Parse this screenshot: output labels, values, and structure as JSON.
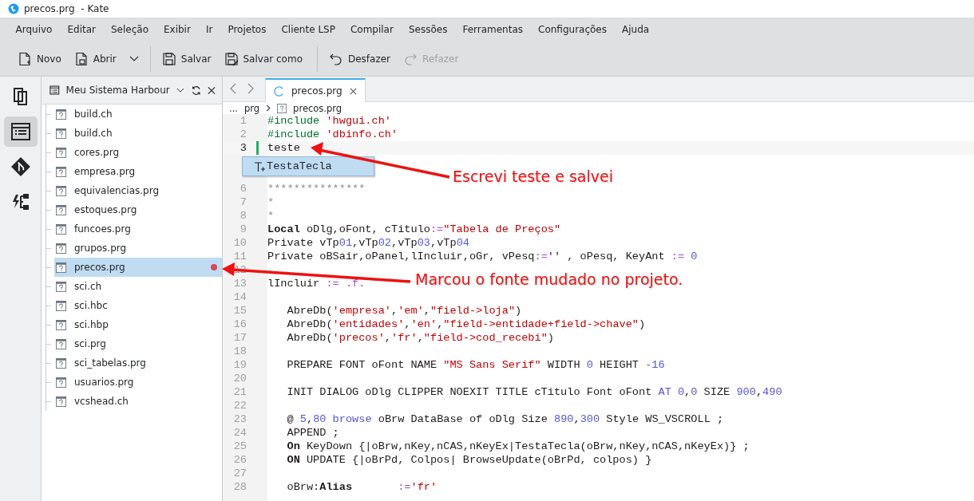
{
  "window": {
    "title": "precos.prg  - Kate"
  },
  "menu": [
    "Arquivo",
    "Editar",
    "Seleção",
    "Exibir",
    "Ir",
    "Projetos",
    "Cliente LSP",
    "Compilar",
    "Sessões",
    "Ferramentas",
    "Configurações",
    "Ajuda"
  ],
  "toolbar": [
    {
      "kind": "new",
      "label": "Novo",
      "disabled": false
    },
    {
      "kind": "open",
      "label": "Abrir",
      "disabled": false,
      "dropdown": true,
      "separator_after": true
    },
    {
      "kind": "save",
      "label": "Salvar",
      "disabled": false
    },
    {
      "kind": "saveas",
      "label": "Salvar como",
      "disabled": false,
      "separator_after": true
    },
    {
      "kind": "undo",
      "label": "Desfazer",
      "disabled": false
    },
    {
      "kind": "redo",
      "label": "Refazer",
      "disabled": true
    }
  ],
  "sidebar": [
    {
      "kind": "documents",
      "selected": false
    },
    {
      "kind": "project",
      "selected": true
    },
    {
      "kind": "git",
      "selected": false
    },
    {
      "kind": "lsp",
      "selected": false
    }
  ],
  "project": {
    "title": "Meu Sistema Harbour",
    "files": [
      {
        "name": "build.ch",
        "selected": false,
        "modified": false
      },
      {
        "name": "build.ch",
        "selected": false,
        "modified": false
      },
      {
        "name": "cores.prg",
        "selected": false,
        "modified": false
      },
      {
        "name": "empresa.prg",
        "selected": false,
        "modified": false
      },
      {
        "name": "equivalencias.prg",
        "selected": false,
        "modified": false
      },
      {
        "name": "estoques.prg",
        "selected": false,
        "modified": false
      },
      {
        "name": "funcoes.prg",
        "selected": false,
        "modified": false
      },
      {
        "name": "grupos.prg",
        "selected": false,
        "modified": false
      },
      {
        "name": "precos.prg",
        "selected": true,
        "modified": true
      },
      {
        "name": "sci.ch",
        "selected": false,
        "modified": false
      },
      {
        "name": "sci.hbc",
        "selected": false,
        "modified": false
      },
      {
        "name": "sci.hbp",
        "selected": false,
        "modified": false
      },
      {
        "name": "sci.prg",
        "selected": false,
        "modified": false
      },
      {
        "name": "sci_tabelas.prg",
        "selected": false,
        "modified": false
      },
      {
        "name": "usuarios.prg",
        "selected": false,
        "modified": false
      },
      {
        "name": "vcshead.ch",
        "selected": false,
        "modified": false
      }
    ]
  },
  "tabs": [
    {
      "label": "precos.prg",
      "selected": true
    }
  ],
  "breadcrumb": [
    "...",
    "prg",
    "precos.prg"
  ],
  "code": [
    {
      "kind": "line",
      "number": "1",
      "current": false,
      "code": [
        {
          "kind": "pre",
          "text": "#include "
        },
        {
          "kind": "s",
          "text": "'hwgui.ch'"
        }
      ]
    },
    {
      "kind": "line",
      "number": "2",
      "current": false,
      "code": [
        {
          "kind": "pre",
          "text": "#include "
        },
        {
          "kind": "s",
          "text": "'dbinfo.ch'"
        }
      ]
    },
    {
      "kind": "line",
      "number": "3",
      "current": true,
      "modified": true,
      "code": [
        {
          "kind": "p",
          "text": "teste"
        }
      ]
    },
    {
      "kind": "completion",
      "label": "TestaTecla"
    },
    {
      "kind": "line",
      "number": "6",
      "current": false,
      "code": [
        {
          "kind": "c",
          "text": "***************"
        }
      ]
    },
    {
      "kind": "line",
      "number": "7",
      "current": false,
      "code": [
        {
          "kind": "c",
          "text": "*"
        }
      ]
    },
    {
      "kind": "line",
      "number": "8",
      "current": false,
      "code": [
        {
          "kind": "c",
          "text": "*"
        }
      ]
    },
    {
      "kind": "line",
      "number": "9",
      "current": false,
      "code": [
        {
          "kind": "kw",
          "text": "Local"
        },
        {
          "kind": "p",
          "text": " oDlg,oFont, cTitulo"
        },
        {
          "kind": "op",
          "text": ":="
        },
        {
          "kind": "s",
          "text": "\"Tabela de Preços\""
        }
      ]
    },
    {
      "kind": "line",
      "number": "10",
      "current": false,
      "code": [
        {
          "kind": "p",
          "text": "Private vTp"
        },
        {
          "kind": "n",
          "text": "01"
        },
        {
          "kind": "p",
          "text": ",vTp"
        },
        {
          "kind": "n",
          "text": "02"
        },
        {
          "kind": "p",
          "text": ",vTp"
        },
        {
          "kind": "n",
          "text": "03"
        },
        {
          "kind": "p",
          "text": ",vTp"
        },
        {
          "kind": "n",
          "text": "04"
        }
      ]
    },
    {
      "kind": "line",
      "number": "11",
      "current": false,
      "code": [
        {
          "kind": "p",
          "text": "Private oBSair,oPanel,lIncluir,oGr, vPesq"
        },
        {
          "kind": "op",
          "text": ":="
        },
        {
          "kind": "p",
          "text": "'' , oPesq, KeyAnt "
        },
        {
          "kind": "op",
          "text": ":="
        },
        {
          "kind": "n",
          "text": " 0"
        }
      ]
    },
    {
      "kind": "line",
      "number": "12",
      "current": false
    },
    {
      "kind": "line",
      "number": "13",
      "current": false,
      "code": [
        {
          "kind": "p",
          "text": "lIncluir "
        },
        {
          "kind": "op",
          "text": ":= .f."
        }
      ]
    },
    {
      "kind": "line",
      "number": "14",
      "current": false
    },
    {
      "kind": "line",
      "number": "15",
      "current": false,
      "code": [
        {
          "kind": "p",
          "text": "   AbreDb("
        },
        {
          "kind": "s",
          "text": "'empresa'"
        },
        {
          "kind": "p",
          "text": ","
        },
        {
          "kind": "s",
          "text": "'em'"
        },
        {
          "kind": "p",
          "text": ","
        },
        {
          "kind": "s",
          "text": "\"field->loja\""
        },
        {
          "kind": "p",
          "text": ")"
        }
      ]
    },
    {
      "kind": "line",
      "number": "16",
      "current": false,
      "code": [
        {
          "kind": "p",
          "text": "   AbreDb("
        },
        {
          "kind": "s",
          "text": "'entidades'"
        },
        {
          "kind": "p",
          "text": ","
        },
        {
          "kind": "s",
          "text": "'en'"
        },
        {
          "kind": "p",
          "text": ","
        },
        {
          "kind": "s",
          "text": "\"field->entidade+field->chave\""
        },
        {
          "kind": "p",
          "text": ")"
        }
      ]
    },
    {
      "kind": "line",
      "number": "17",
      "current": false,
      "code": [
        {
          "kind": "p",
          "text": "   AbreDb("
        },
        {
          "kind": "s",
          "text": "'precos'"
        },
        {
          "kind": "p",
          "text": ","
        },
        {
          "kind": "s",
          "text": "'fr'"
        },
        {
          "kind": "p",
          "text": ","
        },
        {
          "kind": "s",
          "text": "\"field->cod_recebi\""
        },
        {
          "kind": "p",
          "text": ")"
        }
      ]
    },
    {
      "kind": "line",
      "number": "18",
      "current": false
    },
    {
      "kind": "line",
      "number": "19",
      "current": false,
      "code": [
        {
          "kind": "p",
          "text": "   PREPARE FONT oFont NAME "
        },
        {
          "kind": "s",
          "text": "\"MS Sans Serif\""
        },
        {
          "kind": "p",
          "text": " WIDTH "
        },
        {
          "kind": "n",
          "text": "0"
        },
        {
          "kind": "p",
          "text": " HEIGHT "
        },
        {
          "kind": "n",
          "text": "-16"
        }
      ]
    },
    {
      "kind": "line",
      "number": "20",
      "current": false
    },
    {
      "kind": "line",
      "number": "21",
      "current": false,
      "code": [
        {
          "kind": "p",
          "text": "   INIT DIALOG oDlg CLIPPER NOEXIT TITLE cTitulo Font oFont "
        },
        {
          "kind": "n",
          "text": "AT 0"
        },
        {
          "kind": "p",
          "text": ","
        },
        {
          "kind": "n",
          "text": "0"
        },
        {
          "kind": "p",
          "text": " SIZE "
        },
        {
          "kind": "n",
          "text": "900"
        },
        {
          "kind": "p",
          "text": ","
        },
        {
          "kind": "n",
          "text": "490"
        }
      ]
    },
    {
      "kind": "line",
      "number": "22",
      "current": false
    },
    {
      "kind": "line",
      "number": "23",
      "current": false,
      "code": [
        {
          "kind": "p",
          "text": "   @ "
        },
        {
          "kind": "n",
          "text": "5"
        },
        {
          "kind": "p",
          "text": ","
        },
        {
          "kind": "n",
          "text": "80 browse"
        },
        {
          "kind": "p",
          "text": " oBrw DataBase of oDlg Size "
        },
        {
          "kind": "n",
          "text": "890"
        },
        {
          "kind": "p",
          "text": ","
        },
        {
          "kind": "n",
          "text": "300"
        },
        {
          "kind": "p",
          "text": " Style WS_VSCROLL ;"
        }
      ]
    },
    {
      "kind": "line",
      "number": "24",
      "current": false,
      "code": [
        {
          "kind": "p",
          "text": "   APPEND ;"
        }
      ]
    },
    {
      "kind": "line",
      "number": "25",
      "current": false,
      "code": [
        {
          "kind": "kw",
          "text": "   On"
        },
        {
          "kind": "p",
          "text": " KeyDown {|oBrw,nKey,nCAS,nKeyEx|TestaTecla(oBrw,nKey,nCAS,nKeyEx)} ;"
        }
      ]
    },
    {
      "kind": "line",
      "number": "26",
      "current": false,
      "code": [
        {
          "kind": "kw",
          "text": "   ON"
        },
        {
          "kind": "p",
          "text": " UPDATE {|oBrPd, Colpos| BrowseUpdate(oBrPd, colpos) }"
        }
      ]
    },
    {
      "kind": "line",
      "number": "27",
      "current": false
    },
    {
      "kind": "line",
      "number": "28",
      "current": false,
      "code": [
        {
          "kind": "p",
          "text": "   oBrw:"
        },
        {
          "kind": "kw",
          "text": "Alias"
        },
        {
          "kind": "op",
          "text": "       :="
        },
        {
          "kind": "s",
          "text": "'fr'"
        }
      ]
    }
  ],
  "annotations": [
    "Escrevi teste e salvei",
    "Marcou o fonte mudado no projeto."
  ]
}
